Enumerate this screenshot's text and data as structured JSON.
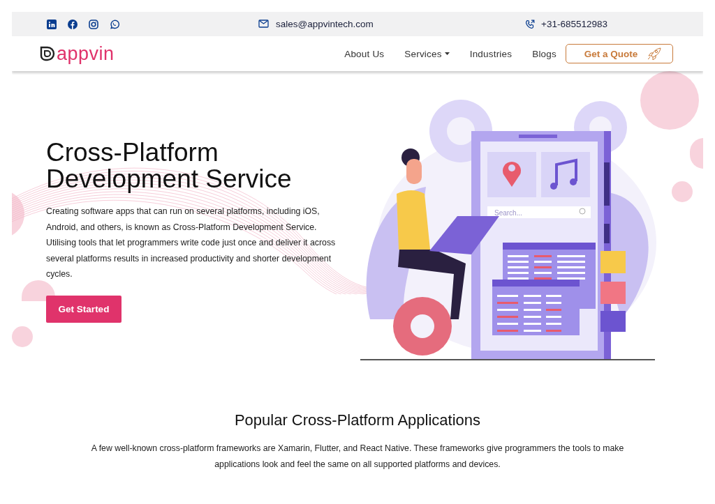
{
  "top_bar": {
    "social_links": [
      {
        "kind": "linkedin"
      },
      {
        "kind": "facebook"
      },
      {
        "kind": "instagram"
      },
      {
        "kind": "whatsapp"
      }
    ],
    "email": "sales@appvintech.com",
    "phone": "+31-685512983"
  },
  "nav": {
    "logo": "appvin",
    "items": [
      {
        "label": "About Us",
        "dropdown": false
      },
      {
        "label": "Services",
        "dropdown": true
      },
      {
        "label": "Industries",
        "dropdown": false
      },
      {
        "label": "Blogs",
        "dropdown": false
      }
    ],
    "cta": "Get a Quote"
  },
  "hero": {
    "title_lines": [
      "Cross-Platform",
      "Development Service"
    ],
    "text": "Creating software apps that can run on several platforms, including iOS, Android, and others, is known as Cross-Platform Development Service. Utilising tools that let programmers write code just once and deliver it across several platforms results in increased productivity and shorter development cycles.",
    "button": "Get Started",
    "illustration": {
      "search_placeholder": "Search..."
    }
  },
  "section": {
    "title": "Popular Cross-Platform Applications",
    "text": "A few well-known cross-platform frameworks are Xamarin, Flutter, and React Native. These frameworks give programmers the tools to make applications look and feel the same on all supported platforms and devices."
  }
}
